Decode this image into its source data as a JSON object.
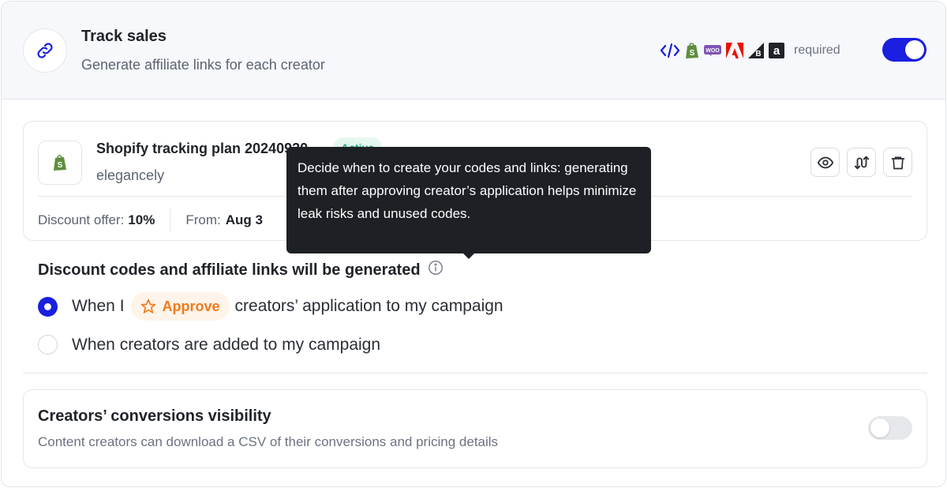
{
  "track_sales": {
    "title": "Track sales",
    "subtitle": "Generate affiliate links for each creator",
    "integrations": [
      "code-icon",
      "shopify-icon",
      "woocommerce-icon",
      "adobe-icon",
      "bigcommerce-icon",
      "amazon-icon"
    ],
    "woo_label": "WOO",
    "amazon_label": "a",
    "required_label": "required",
    "enabled": true
  },
  "plan": {
    "title": "Shopify tracking plan 20240930",
    "status": "Active",
    "store": "elegancely",
    "discount_label": "Discount offer:",
    "discount_value": "10%",
    "from_label": "From:",
    "from_value": "Aug 3"
  },
  "tooltip": {
    "text": "Decide when to create your codes and links: generating them after approving creator’s application helps minimize leak risks and unused codes."
  },
  "generation": {
    "title": "Discount codes and affiliate links will be generated",
    "option1_prefix": "When I",
    "option1_pill": "Approve",
    "option1_suffix": "creators’ application to my campaign",
    "option2": "When creators are added to my campaign",
    "selected": 1
  },
  "visibility": {
    "title": "Creators’ conversions visibility",
    "subtitle": "Content creators can download a CSV of their conversions and pricing details",
    "enabled": false
  },
  "colors": {
    "accent": "#1a1fe0",
    "active_green": "#22b07d",
    "approve_orange": "#f07a1a",
    "tooltip_bg": "#1d2024"
  }
}
